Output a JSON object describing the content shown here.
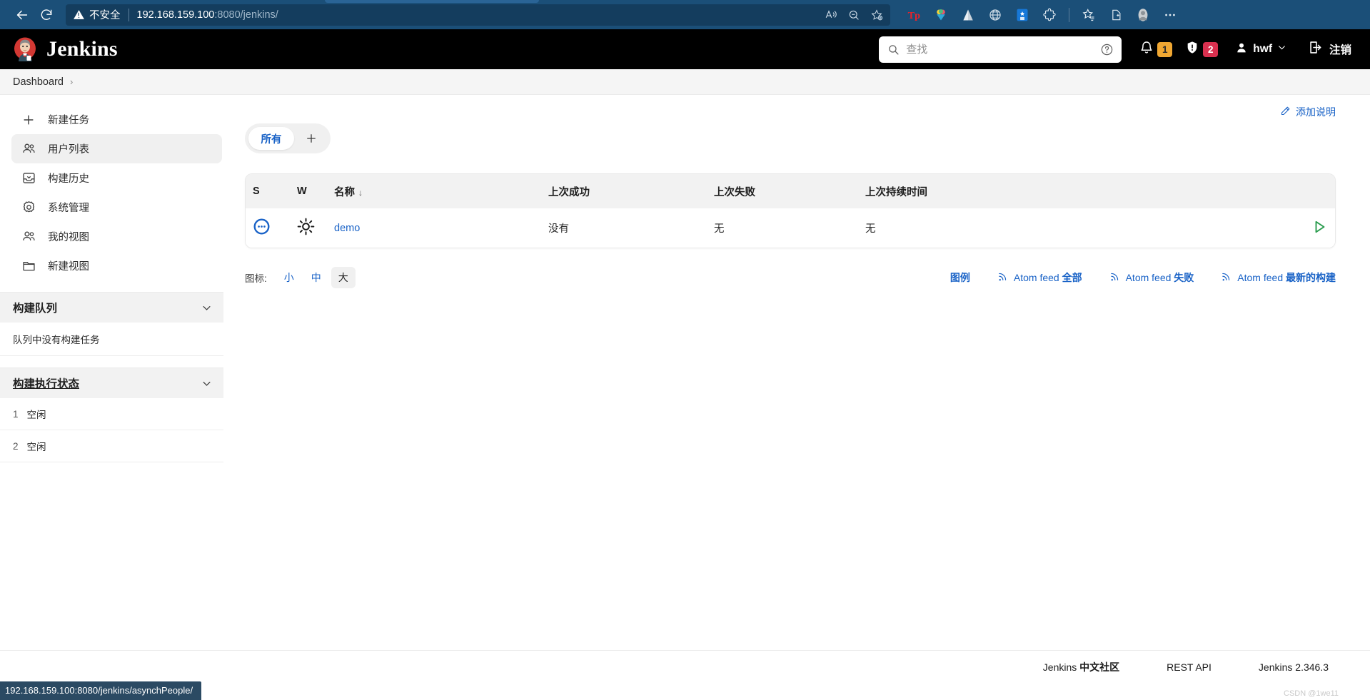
{
  "browser": {
    "back_label": "Back",
    "reload_label": "Reload",
    "security_label": "不安全",
    "url_host": "192.168.159.100",
    "url_rest": ":8080/jenkins/",
    "read_aloud_label": "Read aloud",
    "zoom_label": "Zoom",
    "favorite_label": "Add to favorites",
    "extensions": [
      "tp-extension-icon",
      "shaved-ice-icon",
      "triangle-icon",
      "globe-icon",
      "blue-app-icon",
      "puzzle-icon"
    ],
    "collections_label": "Collections",
    "favorites_bar_label": "Favorites",
    "profile_label": "Profile",
    "more_label": "Settings and more"
  },
  "header": {
    "brand": "Jenkins",
    "search_placeholder": "查找",
    "search_value": "",
    "help_label": "?",
    "notifications_count": "1",
    "security_count": "2",
    "user_name": "hwf",
    "logout_label": "注销",
    "colors": {
      "amber": "#f0a732",
      "red": "#d9304f"
    }
  },
  "breadcrumb": {
    "items": [
      "Dashboard"
    ],
    "separator": "›"
  },
  "sidebar": {
    "items": [
      {
        "label": "新建任务",
        "icon": "plus-icon",
        "active": false
      },
      {
        "label": "用户列表",
        "icon": "people-icon",
        "active": true
      },
      {
        "label": "构建历史",
        "icon": "inbox-icon",
        "active": false
      },
      {
        "label": "系统管理",
        "icon": "gear-icon",
        "active": false
      },
      {
        "label": "我的视图",
        "icon": "people-icon",
        "active": false
      },
      {
        "label": "新建视图",
        "icon": "folder-icon",
        "active": false
      }
    ],
    "build_queue": {
      "title": "构建队列",
      "empty_text": "队列中没有构建任务"
    },
    "build_executor": {
      "title": "构建执行状态",
      "executors": [
        {
          "num": "1",
          "status": "空闲"
        },
        {
          "num": "2",
          "status": "空闲"
        }
      ]
    }
  },
  "main": {
    "add_description_label": "添加说明",
    "tabs": [
      {
        "label": "所有",
        "active": true
      }
    ],
    "add_tab_label": "+",
    "table": {
      "columns": [
        "S",
        "W",
        "名称",
        "上次成功",
        "上次失败",
        "上次持续时间",
        ""
      ],
      "sort_indicator": "↓",
      "rows": [
        {
          "status_icon": "pending-status-icon",
          "weather_icon": "sunny-weather-icon",
          "name": "demo",
          "last_success": "没有",
          "last_failure": "无",
          "last_duration": "无",
          "action": "build-now-icon"
        }
      ]
    },
    "icon_size": {
      "label": "图标:",
      "options": [
        {
          "label": "小",
          "active": false
        },
        {
          "label": "中",
          "active": false
        },
        {
          "label": "大",
          "active": true
        }
      ]
    },
    "legend_label": "图例",
    "feeds": [
      {
        "prefix": "Atom feed ",
        "suffix": "全部"
      },
      {
        "prefix": "Atom feed ",
        "suffix": "失败"
      },
      {
        "prefix": "Atom feed ",
        "suffix": "最新的构建"
      }
    ]
  },
  "footer": {
    "community_prefix": "Jenkins ",
    "community_zh": "中文社区",
    "rest_api": "REST API",
    "version": "Jenkins 2.346.3",
    "watermark": "CSDN @1we11"
  },
  "status_bar": {
    "url": "192.168.159.100:8080/jenkins/asynchPeople/"
  }
}
